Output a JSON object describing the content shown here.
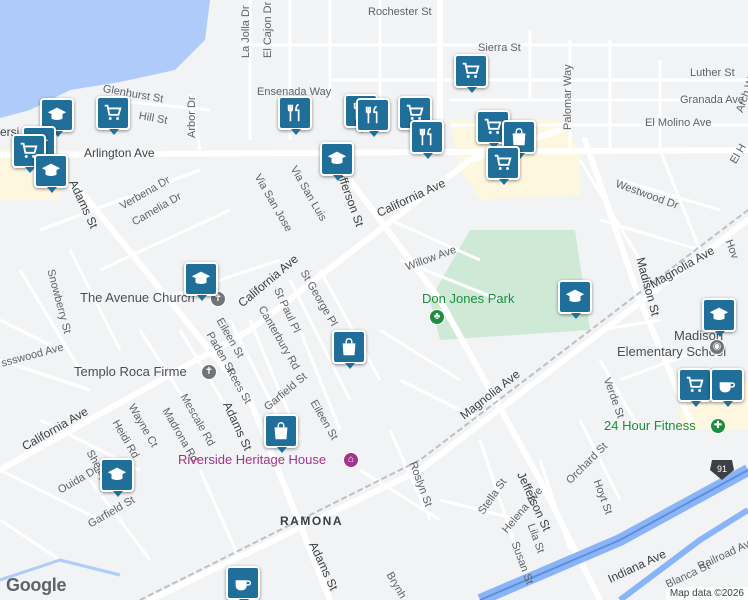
{
  "streets": {
    "rochester": "Rochester St",
    "sierra": "Sierra St",
    "luther": "Luther St",
    "granada": "Granada Ave",
    "el_molino": "El Molino Ave",
    "glenhurst": "Glenhurst St",
    "hill": "Hill St",
    "ensenada": "Ensenada Way",
    "la_jolla": "La Jolla Dr",
    "el_cajon": "El Cajon Dr",
    "arbor": "Arbor Dr",
    "arlington": "Arlington Ave",
    "palomar": "Palomar Way",
    "el_h": "El H",
    "arch": "Arch W",
    "adams_n": "Adams St",
    "verbena": "Verbena Dr",
    "camelia": "Camelia Dr",
    "via_san_jose": "Via San Jose",
    "via_san_luis": "Via San Luis",
    "jefferson_n": "Jefferson St",
    "california_e": "California Ave",
    "westwood": "Westwood Dr",
    "willow": "Willow Ave",
    "madison": "Madison St",
    "magnolia_e": "Magnolia Ave",
    "snowberry": "Snowberry St",
    "st_george": "St George Pl",
    "california_mid": "California Ave",
    "st_paul": "St Paul Pl",
    "canterbury": "Canterbury Rd",
    "eileen_w": "Eileen St",
    "paden": "Paden St",
    "wood": "ssswood Ave",
    "rees": "Rees St",
    "adams_mid": "Adams St",
    "garfield_c": "Garfield St",
    "eileen_c": "Eileen St",
    "madrona": "Madrona Rd",
    "mescale": "Mescale Rd",
    "wayne": "Wayne Ct",
    "heidi": "Heidi Rd",
    "california_w": "California Ave",
    "shelby": "Shelby Dr",
    "ouida": "Ouida Dr",
    "garfield_w": "Garfield St",
    "magnolia_c": "Magnolia Ave",
    "roslyn": "Roslyn St",
    "verde": "Verde St",
    "orchard": "Orchard St",
    "hoyt": "Hoyt St",
    "stella": "Stella St",
    "helena": "Helena Ave",
    "lila": "Lila St",
    "jefferson_s": "Jefferson St",
    "susan": "Susan St",
    "indiana": "Indiana Ave",
    "blanca": "Blanca St",
    "railroad": "Railroad Av",
    "adams_s": "Adams St",
    "brynh": "Brynh",
    "hov": "Hov",
    "ersi": "ersi",
    "el_h2": "El H"
  },
  "places": {
    "avenue_church": "The Avenue Church",
    "templo": "Templo Roca Firme",
    "don_jones": "Don Jones Park",
    "madison_school_1": "Madison",
    "madison_school_2": "Elementary School",
    "fitness": "24 Hour Fitness",
    "heritage": "Riverside Heritage House",
    "ramona": "RAMONA"
  },
  "highway_shield": "91",
  "google_logo": "Google",
  "attribution": "Map data ©2026",
  "colors": {
    "road": "#ffffff",
    "minor_road": "#ffffff",
    "arterial": "#ffffff",
    "water": "#aecbfa",
    "freeway": "#8ab4f8",
    "park": "#ceead6",
    "commercial": "#fef7e0",
    "pin": "#1f6f9a"
  },
  "pins": [
    {
      "kind": "shopping-cart-icon"
    },
    {
      "kind": "shopping-cart-icon"
    },
    {
      "kind": "graduation-cap-icon"
    },
    {
      "kind": "graduation-cap-icon"
    },
    {
      "kind": "graduation-cap-icon"
    },
    {
      "kind": "restaurant-icon"
    },
    {
      "kind": "restaurant-icon"
    },
    {
      "kind": "restaurant-icon"
    },
    {
      "kind": "shopping-cart-icon"
    },
    {
      "kind": "graduation-cap-icon"
    },
    {
      "kind": "graduation-cap-icon"
    },
    {
      "kind": "shopping-bag-icon"
    },
    {
      "kind": "shopping-bag-icon"
    },
    {
      "kind": "graduation-cap-icon"
    },
    {
      "kind": "graduation-cap-icon"
    },
    {
      "kind": "shopping-cart-icon"
    },
    {
      "kind": "coffee-cup-icon"
    },
    {
      "kind": "coffee-cup-icon"
    },
    {
      "kind": "graduation-cap-icon"
    }
  ]
}
